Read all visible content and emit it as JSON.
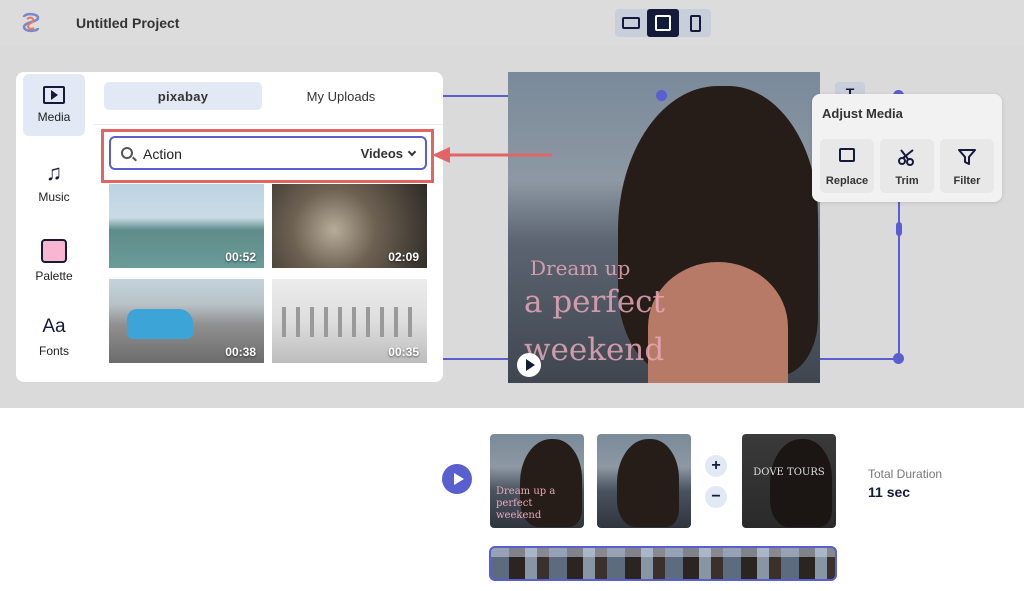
{
  "header": {
    "project_title": "Untitled Project",
    "view_modes": [
      {
        "icon": "landscape-icon",
        "active": false
      },
      {
        "icon": "square-icon",
        "active": true
      },
      {
        "icon": "portrait-icon",
        "active": false
      }
    ]
  },
  "sidebar": {
    "items": [
      {
        "label": "Media",
        "icon": "media-icon",
        "active": true
      },
      {
        "label": "Music",
        "icon": "music-note-icon",
        "active": false
      },
      {
        "label": "Palette",
        "icon": "palette-icon",
        "active": false
      },
      {
        "label": "Fonts",
        "icon": "fonts-icon",
        "active": false
      }
    ],
    "fonts_glyph": "Aa"
  },
  "media_panel": {
    "tabs": [
      {
        "label": "pixabay",
        "active": true
      },
      {
        "label": "My Uploads",
        "active": false
      }
    ],
    "search": {
      "value": "Action",
      "type_filter": "Videos"
    },
    "videos": [
      {
        "duration": "00:52"
      },
      {
        "duration": "02:09"
      },
      {
        "duration": "00:38"
      },
      {
        "duration": "00:35"
      }
    ]
  },
  "preview": {
    "caption_line1": "Dream up",
    "caption_line2": "a perfect",
    "caption_line3": "weekend",
    "text_tool_label": "T"
  },
  "adjust_media": {
    "title": "Adjust Media",
    "actions": [
      {
        "label": "Replace",
        "icon": "replace-image-icon"
      },
      {
        "label": "Trim",
        "icon": "scissors-icon"
      },
      {
        "label": "Filter",
        "icon": "filter-icon"
      }
    ]
  },
  "timeline": {
    "clips": [
      {
        "caption": "Dream up a perfect weekend"
      },
      {
        "caption": ""
      },
      {
        "caption": "DOVE TOURS"
      }
    ],
    "total_duration_label": "Total Duration",
    "total_duration_value": "11 sec",
    "zoom_in": "+",
    "zoom_out": "−"
  },
  "colors": {
    "accent": "#5a5fd0",
    "dark": "#141a3a",
    "highlight": "#e06666",
    "tab_active_bg": "#e3e8f5"
  }
}
